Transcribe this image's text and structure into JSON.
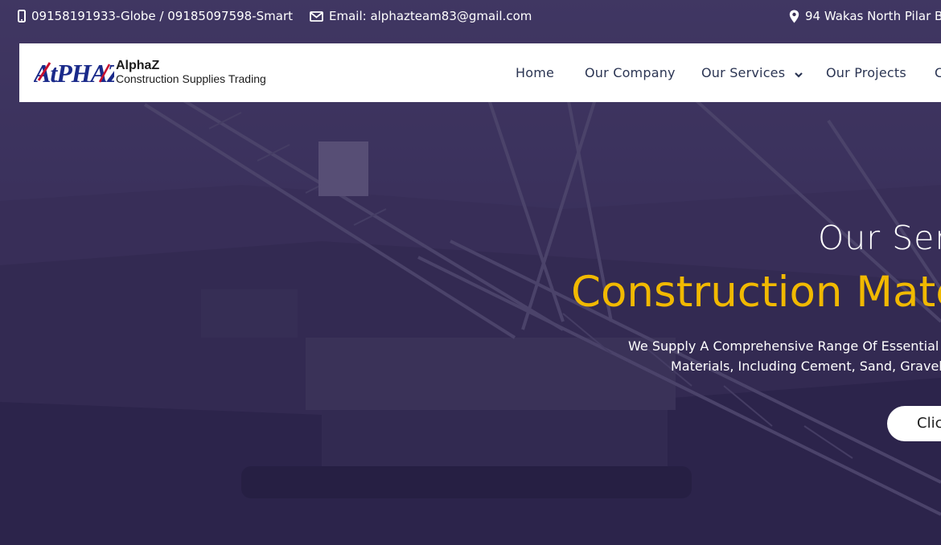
{
  "topbar": {
    "phone": "09158191933-Globe / 09185097598-Smart",
    "email": "Email: alphazteam83@gmail.com",
    "address": "94 Wakas North Pilar B",
    "icons": [
      "mobile-phone-icon",
      "envelope-icon",
      "map-pin-icon"
    ]
  },
  "brand": {
    "logo_mark": "AtPHAZ",
    "name": "AlphaZ",
    "tagline": "Construction Supplies Trading",
    "colors": {
      "logo_blue": "#1a2a8a",
      "logo_red": "#c8102e"
    }
  },
  "nav": {
    "items": [
      {
        "label": "Home"
      },
      {
        "label": "Our Company"
      },
      {
        "label": "Our Services",
        "has_dropdown": true
      },
      {
        "label": "Our Projects"
      },
      {
        "label": "C"
      }
    ]
  },
  "hero": {
    "subtitle": "Our Serv",
    "title": "Construction Mater",
    "description_line1": "We Supply A Comprehensive Range Of Essential C",
    "description_line2": "Materials, Including Cement, Sand, Gravel, A",
    "cta_label": "Clic",
    "colors": {
      "title": "#f1b900",
      "overlay": "#22184e"
    }
  }
}
